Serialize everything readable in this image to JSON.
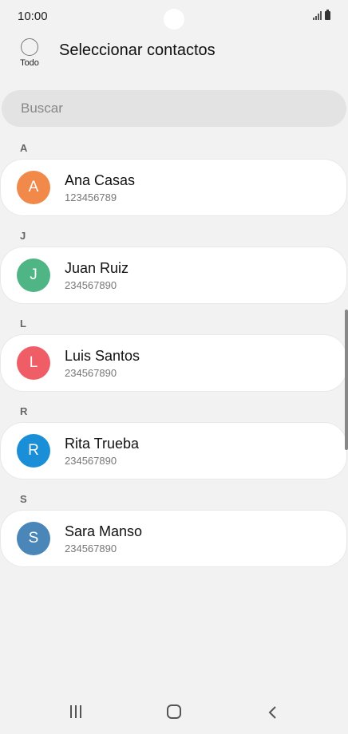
{
  "status": {
    "time": "10:00"
  },
  "header": {
    "select_all_label": "Todo",
    "title": "Seleccionar contactos"
  },
  "search": {
    "placeholder": "Buscar"
  },
  "sections": [
    {
      "letter": "A",
      "contact": {
        "initial": "A",
        "name": "Ana Casas",
        "number": "123456789",
        "color": "#f0894a"
      }
    },
    {
      "letter": "J",
      "contact": {
        "initial": "J",
        "name": "Juan Ruiz",
        "number": "234567890",
        "color": "#4fb585"
      }
    },
    {
      "letter": "L",
      "contact": {
        "initial": "L",
        "name": "Luis Santos",
        "number": "234567890",
        "color": "#ef5d67"
      }
    },
    {
      "letter": "R",
      "contact": {
        "initial": "R",
        "name": "Rita Trueba",
        "number": "234567890",
        "color": "#1a8fd8"
      }
    },
    {
      "letter": "S",
      "contact": {
        "initial": "S",
        "name": "Sara Manso",
        "number": "234567890",
        "color": "#4a86b8"
      }
    }
  ],
  "icons": {
    "recent": "recent-apps-icon",
    "home": "home-icon",
    "back": "back-icon"
  }
}
